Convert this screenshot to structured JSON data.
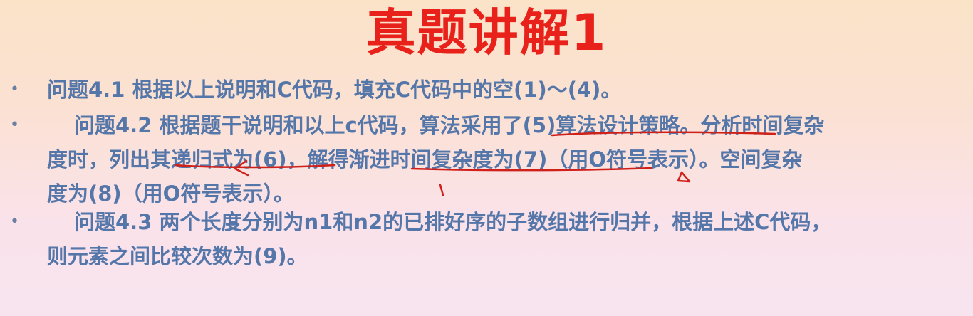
{
  "title": "真题讲解1",
  "bullet_glyph": "•",
  "q1": {
    "line1": "问题4.1 根据以上说明和C代码，填充C代码中的空(1)～(4)。"
  },
  "q2": {
    "line1": "问题4.2 根据题干说明和以上c代码，算法采用了(5)算法设计策略。分析时间复杂",
    "line2": "度时，列出其递归式为(6)，解得渐进时间复杂度为(7)（用O符号表示）。空间复杂",
    "line3": "度为(8)（用O符号表示）。"
  },
  "q3": {
    "line1": "问题4.3 两个长度分别为n1和n2的已排好序的子数组进行归并，根据上述C代码，",
    "line2": "则元素之间比较次数为(9)。"
  },
  "annotation_color": "#d0201a"
}
